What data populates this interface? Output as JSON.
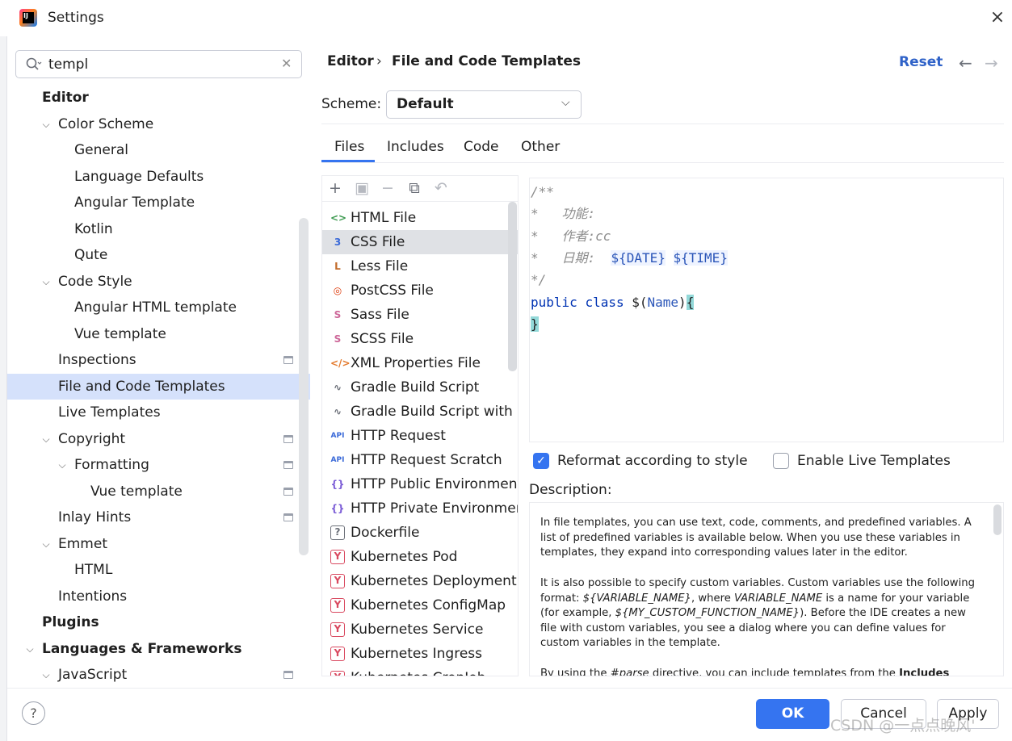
{
  "window": {
    "title": "Settings"
  },
  "search": {
    "value": "templ"
  },
  "tree": [
    {
      "label": "Editor",
      "level": 0,
      "bold": true,
      "chevron": ""
    },
    {
      "label": "Color Scheme",
      "level": 1,
      "chevron": "down"
    },
    {
      "label": "General",
      "level": 2,
      "chevron": ""
    },
    {
      "label": "Language Defaults",
      "level": 2,
      "chevron": ""
    },
    {
      "label": "Angular Template",
      "level": 2,
      "chevron": ""
    },
    {
      "label": "Kotlin",
      "level": 2,
      "chevron": ""
    },
    {
      "label": "Qute",
      "level": 2,
      "chevron": ""
    },
    {
      "label": "Code Style",
      "level": 1,
      "chevron": "down"
    },
    {
      "label": "Angular HTML template",
      "level": 2,
      "chevron": ""
    },
    {
      "label": "Vue template",
      "level": 2,
      "chevron": ""
    },
    {
      "label": "Inspections",
      "level": 1,
      "chevron": "",
      "project": true
    },
    {
      "label": "File and Code Templates",
      "level": 1,
      "chevron": "",
      "selected": true
    },
    {
      "label": "Live Templates",
      "level": 1,
      "chevron": ""
    },
    {
      "label": "Copyright",
      "level": 1,
      "chevron": "down",
      "project": true
    },
    {
      "label": "Formatting",
      "level": 2,
      "chevron": "down",
      "project": true
    },
    {
      "label": "Vue template",
      "level": 3,
      "chevron": "",
      "project": true
    },
    {
      "label": "Inlay Hints",
      "level": 1,
      "chevron": "",
      "project": true
    },
    {
      "label": "Emmet",
      "level": 1,
      "chevron": "down"
    },
    {
      "label": "HTML",
      "level": 2,
      "chevron": ""
    },
    {
      "label": "Intentions",
      "level": 1,
      "chevron": ""
    },
    {
      "label": "Plugins",
      "level": 0,
      "bold": true,
      "chevron": ""
    },
    {
      "label": "Languages & Frameworks",
      "level": 0,
      "bold": true,
      "chevron": "down"
    },
    {
      "label": "JavaScript",
      "level": 1,
      "chevron": "down",
      "project": true
    }
  ],
  "header": {
    "breadcrumb_root": "Editor",
    "breadcrumb_sep": "›",
    "breadcrumb_current": "File and Code Templates",
    "reset_label": "Reset",
    "back_glyph": "←",
    "forward_glyph": "→"
  },
  "scheme": {
    "label": "Scheme:",
    "value": "Default"
  },
  "tabs": [
    "Files",
    "Includes",
    "Code",
    "Other"
  ],
  "files": [
    {
      "name": "HTML File",
      "icon": "html-icon",
      "glyph": "<>",
      "color": "#3d9a50"
    },
    {
      "name": "CSS File",
      "icon": "css-icon",
      "glyph": "3",
      "color": "#3b6ad8",
      "selected": true
    },
    {
      "name": "Less File",
      "icon": "less-icon",
      "glyph": "L",
      "color": "#c26b2a"
    },
    {
      "name": "PostCSS File",
      "icon": "postcss-icon",
      "glyph": "◎",
      "color": "#dd3a0a"
    },
    {
      "name": "Sass File",
      "icon": "sass-icon",
      "glyph": "S",
      "color": "#cd6799"
    },
    {
      "name": "SCSS File",
      "icon": "scss-icon",
      "glyph": "S",
      "color": "#cd6799"
    },
    {
      "name": "XML Properties File",
      "icon": "xml-icon",
      "glyph": "</>",
      "color": "#e3792b"
    },
    {
      "name": "Gradle Build Script",
      "icon": "gradle-icon",
      "glyph": "∿",
      "color": "#6b6f78"
    },
    {
      "name": "Gradle Build Script with wra",
      "icon": "gradle-icon",
      "glyph": "∿",
      "color": "#6b6f78"
    },
    {
      "name": "HTTP Request",
      "icon": "api-icon",
      "glyph": "API",
      "color": "#3b6ad8"
    },
    {
      "name": "HTTP Request Scratch",
      "icon": "api-icon",
      "glyph": "API",
      "color": "#3b6ad8"
    },
    {
      "name": "HTTP Public Environment F",
      "icon": "braces-icon",
      "glyph": "{}",
      "color": "#7a5bd6"
    },
    {
      "name": "HTTP Private Environment F",
      "icon": "braces-icon",
      "glyph": "{}",
      "color": "#7a5bd6"
    },
    {
      "name": "Dockerfile",
      "icon": "unknown-file-icon",
      "glyph": "?",
      "color": "#6b6f78"
    },
    {
      "name": "Kubernetes Pod",
      "icon": "yaml-icon",
      "glyph": "Y",
      "color": "#d9485f"
    },
    {
      "name": "Kubernetes Deployment",
      "icon": "yaml-icon",
      "glyph": "Y",
      "color": "#d9485f"
    },
    {
      "name": "Kubernetes ConfigMap",
      "icon": "yaml-icon",
      "glyph": "Y",
      "color": "#d9485f"
    },
    {
      "name": "Kubernetes Service",
      "icon": "yaml-icon",
      "glyph": "Y",
      "color": "#d9485f"
    },
    {
      "name": "Kubernetes Ingress",
      "icon": "yaml-icon",
      "glyph": "Y",
      "color": "#d9485f"
    },
    {
      "name": "Kubernetes CronJob",
      "icon": "yaml-icon",
      "glyph": "Y",
      "color": "#d9485f"
    }
  ],
  "editor": {
    "lines": [
      [
        [
          "cm",
          "/**"
        ]
      ],
      [
        [
          "cm",
          "*   功能:"
        ]
      ],
      [
        [
          "cm",
          "*   作者:cc"
        ]
      ],
      [
        [
          "cm",
          "*   日期:  "
        ],
        [
          "var",
          "${DATE}"
        ],
        [
          "cm",
          " "
        ],
        [
          "var",
          "${TIME}"
        ]
      ],
      [
        [
          "cm",
          "*/"
        ]
      ],
      [
        [
          "kw",
          "public"
        ],
        [
          "pl",
          " "
        ],
        [
          "kw",
          "class"
        ],
        [
          "pl",
          " $("
        ],
        [
          "ident",
          "Name"
        ],
        [
          "pl",
          ")"
        ],
        [
          "brace-hl",
          "{"
        ]
      ],
      [
        [
          "brace-hl",
          "}"
        ]
      ]
    ]
  },
  "options": {
    "reformat_label": "Reformat according to style",
    "reformat_checked": true,
    "live_templates_label": "Enable Live Templates",
    "live_templates_checked": false
  },
  "description": {
    "label": "Description:",
    "p1": "In file templates, you can use text, code, comments, and predefined variables. A list of predefined variables is available below. When you use these variables in templates, they expand into corresponding values later in the editor.",
    "p2_a": "It is also possible to specify custom variables. Custom variables use the following format: ",
    "p2_var1": "${VARIABLE_NAME}",
    "p2_b": ", where ",
    "p2_var2": "VARIABLE_NAME",
    "p2_c": " is a name for your variable (for example, ",
    "p2_var3": "${MY_CUSTOM_FUNCTION_NAME}",
    "p2_d": "). Before the IDE creates a new file with custom variables, you see a dialog where you can define values for custom variables in the template.",
    "p3_a": "By using the ",
    "p3_dir": "#parse",
    "p3_b": " directive, you can include templates from the ",
    "p3_c": "Includes"
  },
  "buttons": {
    "help": "?",
    "ok": "OK",
    "cancel": "Cancel",
    "apply": "Apply"
  },
  "watermark": "CSDN @一点点晚风'"
}
